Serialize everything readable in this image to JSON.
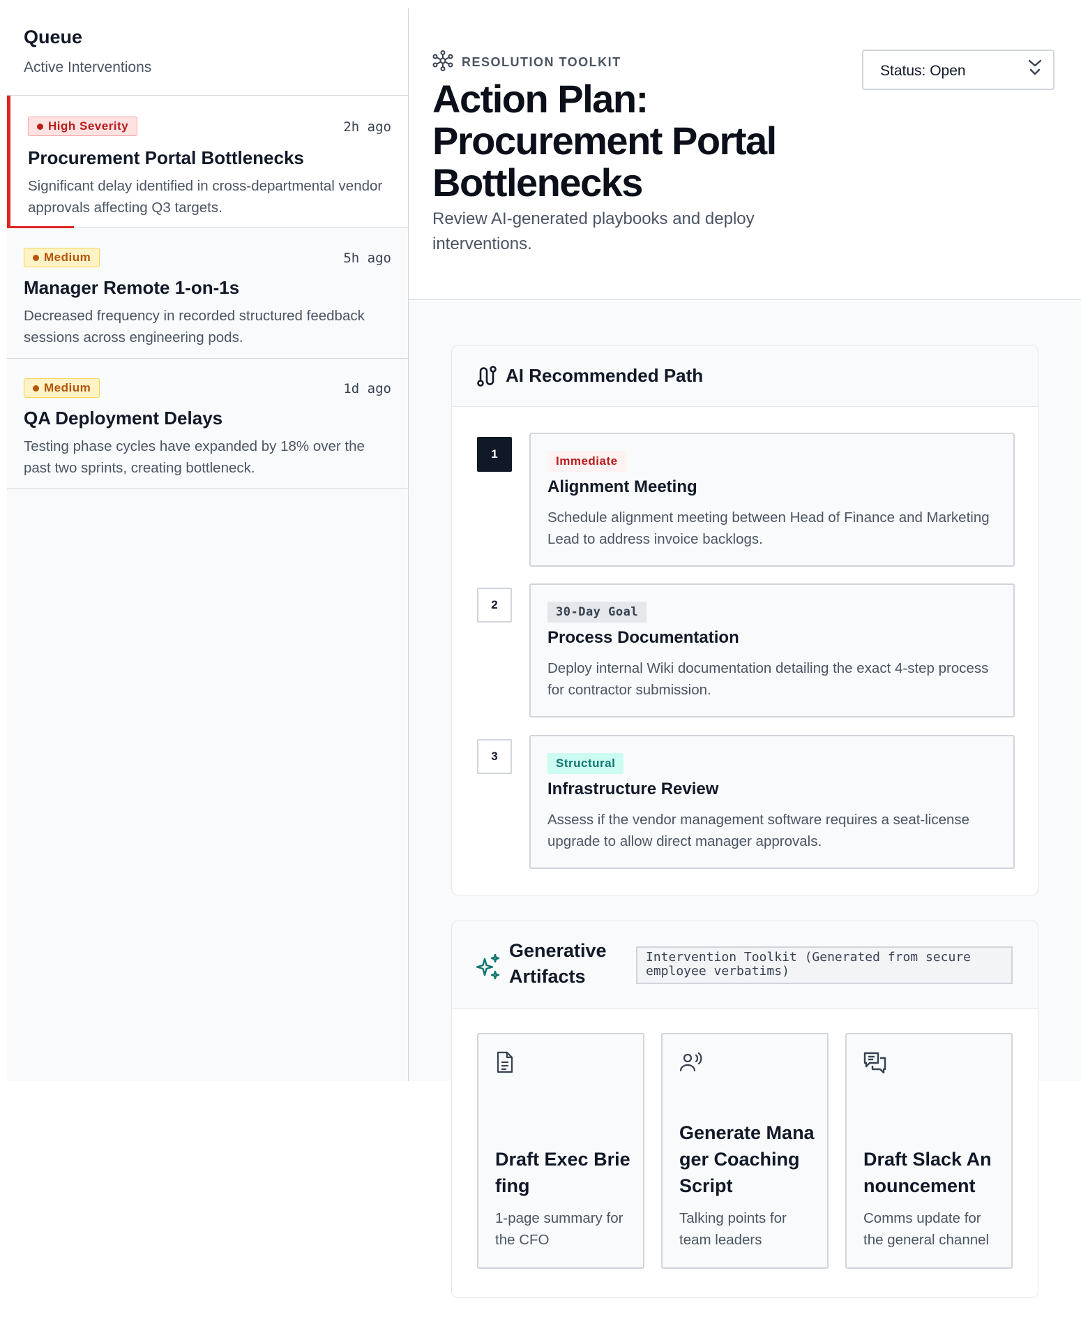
{
  "sidebar": {
    "title": "Queue",
    "subtitle": "Active Interventions",
    "items": [
      {
        "badge": "High Severity",
        "time": "2h ago",
        "title": "Procurement Portal Bottlenecks",
        "description": "Significant delay identified in cross-departmental vendor approvals affecting Q3 targets."
      },
      {
        "badge": "Medium",
        "time": "5h ago",
        "title": "Manager Remote 1-on-1s",
        "description": "Decreased frequency in recorded structured feedback sessions across engineering pods."
      },
      {
        "badge": "Medium",
        "time": "1d ago",
        "title": "QA Deployment Delays",
        "description": "Testing phase cycles have expanded by 18% over the past two sprints, creating bottleneck."
      }
    ]
  },
  "header": {
    "eyebrow": "RESOLUTION TOOLKIT",
    "title": "Action Plan: Procurement Portal Bottlenecks",
    "subtitle": "Review AI-generated playbooks and deploy interventions.",
    "status": "Status: Open"
  },
  "path": {
    "title": "AI Recommended Path",
    "steps": [
      {
        "number": "1",
        "tag": "Immediate",
        "title": "Alignment Meeting",
        "description": "Schedule alignment meeting between Head of Finance and Marketing Lead to address invoice backlogs."
      },
      {
        "number": "2",
        "tag": "30-Day Goal",
        "title": "Process Documentation",
        "description": "Deploy internal Wiki documentation detailing the exact 4-step process for contractor submission."
      },
      {
        "number": "3",
        "tag": "Structural",
        "title": "Infrastructure Review",
        "description": "Assess if the vendor management software requires a seat-license upgrade to allow direct manager approvals."
      }
    ]
  },
  "artifacts": {
    "title": "Generative Artifacts",
    "note": "Intervention Toolkit (Generated from secure\nemployee verbatims)",
    "items": [
      {
        "icon": "document-icon",
        "title": "Draft Exec Briefing",
        "description": "1-page summary for the CFO"
      },
      {
        "icon": "speaking-person-icon",
        "title": "Generate Manager Coaching Script",
        "description": "Talking points for team leaders"
      },
      {
        "icon": "chat-bubbles-icon",
        "title": "Draft Slack Announcement",
        "description": "Comms update for the general channel"
      }
    ]
  },
  "colors": {
    "severity_high": "#b91c1c",
    "severity_medium": "#b45309",
    "tag_immediate": "#b91c1c",
    "tag_structural": "#0f766e",
    "accent_dark": "#111827"
  }
}
